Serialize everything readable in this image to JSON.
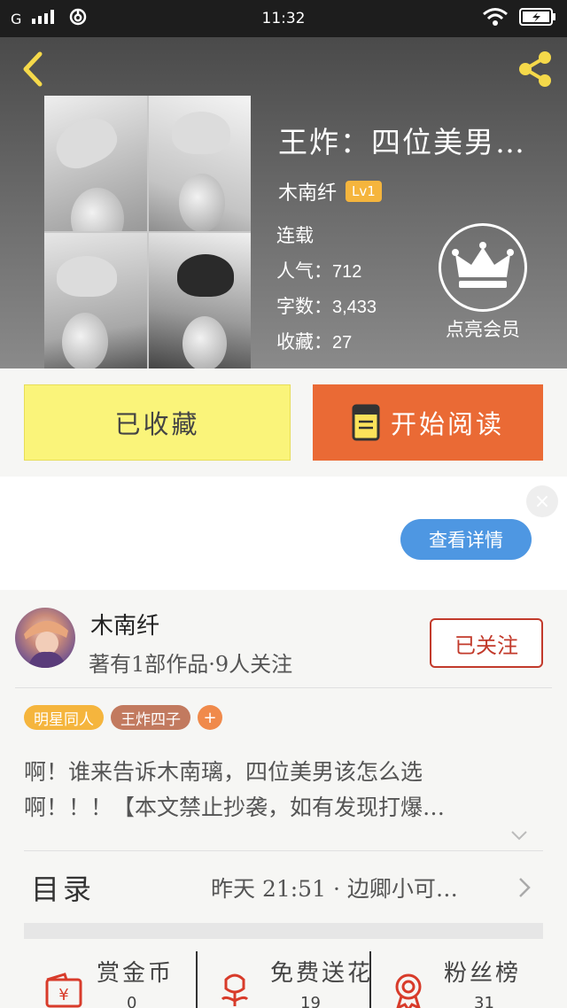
{
  "status_bar": {
    "carrier": "G",
    "time": "11:32"
  },
  "book": {
    "title": "王炸：四位美男…",
    "author": "木南纤",
    "level": "Lv1",
    "status": "连载",
    "popularity_label": "人气：",
    "popularity": "712",
    "word_count_label": "字数：",
    "word_count": "3,433",
    "favorites_label": "收藏：",
    "favorites": "27"
  },
  "vip": {
    "label": "点亮会员"
  },
  "actions": {
    "favorited_label": "已收藏",
    "read_label": "开始阅读"
  },
  "ad": {
    "details_label": "查看详情",
    "close_label": "×"
  },
  "author_profile": {
    "name": "木南纤",
    "meta": "著有1部作品·9人关注",
    "follow_label": "已关注"
  },
  "tags": [
    "明星同人",
    "王炸四子"
  ],
  "tag_add_label": "+",
  "intro": {
    "line1": "啊！谁来告诉木南璃，四位美男该怎么选",
    "line2": "啊！！！【本文禁止抄袭，如有发现打爆…"
  },
  "toc": {
    "label": "目录",
    "latest": "昨天 21:51 · 边卿小可…"
  },
  "bottom": [
    {
      "label": "赏金币",
      "count": "0"
    },
    {
      "label": "免费送花",
      "count": "19"
    },
    {
      "label": "粉丝榜",
      "count": "31"
    }
  ],
  "colors": {
    "favorited_bg": "#faf47a",
    "read_bg": "#ea6a35",
    "follow_accent": "#c23a2b",
    "ad_button": "#4e97e2",
    "level_badge": "#f5b53d"
  }
}
